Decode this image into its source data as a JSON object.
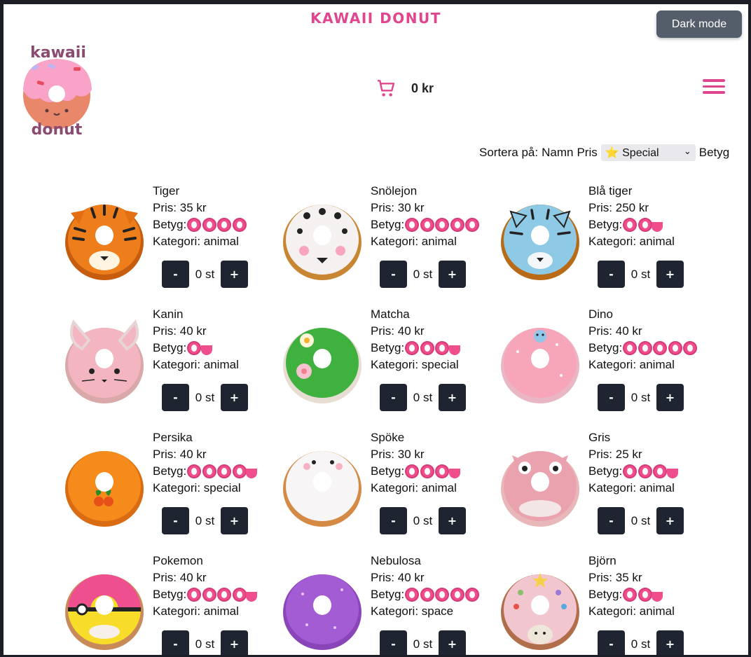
{
  "header": {
    "title": "KAWAII DONUT",
    "dark_mode_label": "Dark mode",
    "cart_total": "0 kr",
    "logo_text_top": "kawaii",
    "logo_text_bottom": "donut"
  },
  "sort": {
    "label": "Sortera på:",
    "option_name": "Namn",
    "option_price": "Pris",
    "selected_category": "⭐ Special",
    "option_rating": "Betyg"
  },
  "labels": {
    "price_prefix": "Pris: ",
    "rating_prefix": "Betyg:",
    "category_prefix": "Kategori: ",
    "minus": "-",
    "plus": "+"
  },
  "products": [
    {
      "name": "Tiger",
      "price": "35 kr",
      "rating": 4,
      "category": "animal",
      "qty": "0 st",
      "icon": "tiger-donut"
    },
    {
      "name": "Snölejon",
      "price": "30 kr",
      "rating": 5,
      "category": "animal",
      "qty": "0 st",
      "icon": "snow-lion-donut"
    },
    {
      "name": "Blå tiger",
      "price": "250 kr",
      "rating": 2.5,
      "category": "animal",
      "qty": "0 st",
      "icon": "blue-tiger-donut"
    },
    {
      "name": "Kanin",
      "price": "40 kr",
      "rating": 1.5,
      "category": "animal",
      "qty": "0 st",
      "icon": "rabbit-donut"
    },
    {
      "name": "Matcha",
      "price": "40 kr",
      "rating": 3.5,
      "category": "special",
      "qty": "0 st",
      "icon": "matcha-donut"
    },
    {
      "name": "Dino",
      "price": "40 kr",
      "rating": 5,
      "category": "animal",
      "qty": "0 st",
      "icon": "dino-donut"
    },
    {
      "name": "Persika",
      "price": "40 kr",
      "rating": 4.5,
      "category": "special",
      "qty": "0 st",
      "icon": "peach-donut"
    },
    {
      "name": "Spöke",
      "price": "30 kr",
      "rating": 3.5,
      "category": "animal",
      "qty": "0 st",
      "icon": "ghost-donut"
    },
    {
      "name": "Gris",
      "price": "25 kr",
      "rating": 3.5,
      "category": "animal",
      "qty": "0 st",
      "icon": "pig-donut"
    },
    {
      "name": "Pokemon",
      "price": "40 kr",
      "rating": 4.5,
      "category": "animal",
      "qty": "0 st",
      "icon": "pokemon-donut"
    },
    {
      "name": "Nebulosa",
      "price": "40 kr",
      "rating": 5,
      "category": "space",
      "qty": "0 st",
      "icon": "nebula-donut"
    },
    {
      "name": "Björn",
      "price": "35 kr",
      "rating": 2.5,
      "category": "animal",
      "qty": "0 st",
      "icon": "bear-donut"
    }
  ],
  "colors": {
    "accent": "#e0458e",
    "button": "#1e2530",
    "dark_mode_button": "#545d6a"
  }
}
